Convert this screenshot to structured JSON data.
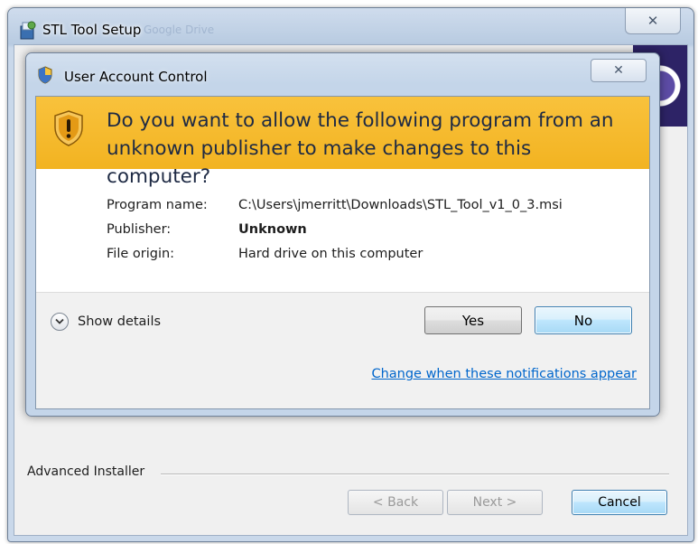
{
  "installer": {
    "title": "STL Tool Setup",
    "ghost_text": "Google Drive",
    "close_glyph": "✕",
    "brand_label": "Advanced Installer",
    "buttons": {
      "back": "< Back",
      "next": "Next >",
      "cancel": "Cancel"
    }
  },
  "uac": {
    "title": "User Account Control",
    "close_glyph": "✕",
    "question": "Do you want to allow the following program from an unknown publisher to make changes to this computer?",
    "fields": {
      "program_name_label": "Program name:",
      "program_name_value": "C:\\Users\\jmerritt\\Downloads\\STL_Tool_v1_0_3.msi",
      "publisher_label": "Publisher:",
      "publisher_value": "Unknown",
      "file_origin_label": "File origin:",
      "file_origin_value": "Hard drive on this computer"
    },
    "show_details": "Show details",
    "yes": "Yes",
    "no": "No",
    "notifications_link": "Change when these notifications appear"
  },
  "colors": {
    "warning_band": "#f9c23c",
    "link": "#0066cc",
    "default_button_border": "#3c7fb1"
  },
  "icons": [
    "installer-app-icon",
    "uac-shield-icon",
    "warning-shield-icon",
    "chevron-down-icon",
    "close-icon"
  ]
}
